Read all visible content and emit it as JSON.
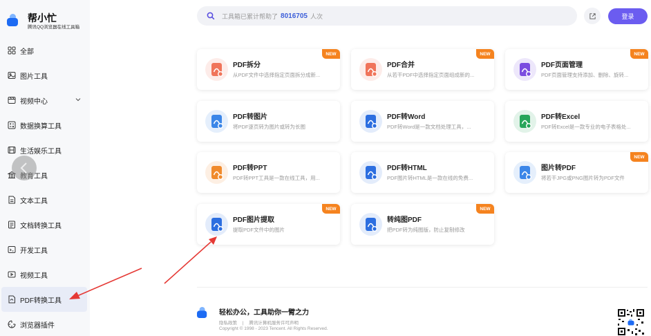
{
  "brand": {
    "name": "帮小忙",
    "subtitle": "腾讯QQ浏览器在线工具箱"
  },
  "sidebar": {
    "items": [
      {
        "label": "全部",
        "icon": "grid-icon"
      },
      {
        "label": "图片工具",
        "icon": "image-icon"
      },
      {
        "label": "视频中心",
        "icon": "video-icon",
        "expandable": true
      },
      {
        "label": "数据换算工具",
        "icon": "calculator-icon"
      },
      {
        "label": "生活娱乐工具",
        "icon": "entertainment-icon"
      },
      {
        "label": "教育工具",
        "icon": "education-icon"
      },
      {
        "label": "文本工具",
        "icon": "text-icon"
      },
      {
        "label": "文档转换工具",
        "icon": "document-icon"
      },
      {
        "label": "开发工具",
        "icon": "code-icon"
      },
      {
        "label": "视频工具",
        "icon": "film-icon"
      },
      {
        "label": "PDF转换工具",
        "icon": "pdf-icon",
        "active": true
      },
      {
        "label": "浏览器插件",
        "icon": "plugin-icon"
      }
    ]
  },
  "search": {
    "prefix": "工具箱已累计帮助了",
    "count": "8016705",
    "suffix": "人次"
  },
  "header": {
    "login_label": "登录"
  },
  "cards": [
    {
      "title": "PDF拆分",
      "desc": "从PDF文件中选择指定页面拆分成新...",
      "new": true,
      "icon": "pdf-split-icon",
      "color": "#f0745a"
    },
    {
      "title": "PDF合并",
      "desc": "从若干PDF中选择指定页面组成新的...",
      "new": true,
      "icon": "pdf-merge-icon",
      "color": "#f0745a"
    },
    {
      "title": "PDF页面管理",
      "desc": "PDF页面管理支持添加、删除、旋转...",
      "new": true,
      "icon": "pdf-page-manage-icon",
      "color": "#7b4ce0"
    },
    {
      "title": "PDF转图片",
      "desc": "将PDF逐页转为图片或转为长图",
      "new": false,
      "icon": "pdf-to-image-icon",
      "color": "#3b86e8"
    },
    {
      "title": "PDF转Word",
      "desc": "PDF转Word是一款文档处理工具，...",
      "new": false,
      "icon": "pdf-to-word-icon",
      "color": "#2c6ee0"
    },
    {
      "title": "PDF转Excel",
      "desc": "PDF转Excel是一款专业的电子表格处...",
      "new": false,
      "icon": "pdf-to-excel-icon",
      "color": "#27a55a"
    },
    {
      "title": "PDF转PPT",
      "desc": "PDF转PPT工具是一款在线工具，用...",
      "new": false,
      "icon": "pdf-to-ppt-icon",
      "color": "#f08a2c"
    },
    {
      "title": "PDF转HTML",
      "desc": "PDF图片转HTML是一款在线的免费...",
      "new": false,
      "icon": "pdf-to-html-icon",
      "color": "#2c6ee0"
    },
    {
      "title": "图片转PDF",
      "desc": "将若干JPG或PNG图片转为PDF文件",
      "new": true,
      "icon": "image-to-pdf-icon",
      "color": "#3b86e8"
    },
    {
      "title": "PDF图片提取",
      "desc": "提取PDF文件中的图片",
      "new": true,
      "icon": "pdf-image-extract-icon",
      "color": "#2c6ee0"
    },
    {
      "title": "转纯图PDF",
      "desc": "把PDF转为纯图版，防止复制修改",
      "new": true,
      "icon": "pure-image-pdf-icon",
      "color": "#2c6ee0"
    }
  ],
  "badge_label": "NEW",
  "footer": {
    "slogan": "轻松办公，工具助你一臂之力",
    "links": [
      "隐私政策",
      "|",
      "腾讯计算机服务许可声明"
    ],
    "copyright": "Copyright © 1998 - 2023 Tencent. All Rights Reserved."
  },
  "colors": {
    "accent": "#6b5cf0",
    "count": "#3d5fd9",
    "badge": "#f5831f",
    "arrow": "#e53935"
  }
}
